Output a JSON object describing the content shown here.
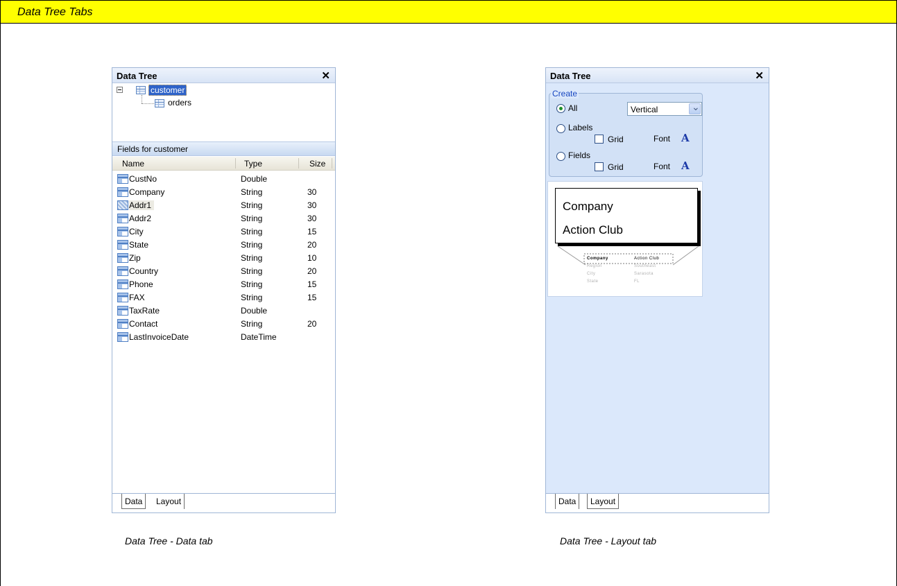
{
  "banner": {
    "title": "Data Tree Tabs"
  },
  "left_panel": {
    "title": "Data Tree",
    "close_glyph": "✕",
    "tree": {
      "root": {
        "label": "customer",
        "icon": "table-icon"
      },
      "child": {
        "label": "orders",
        "icon": "table-icon"
      }
    },
    "fields_header": "Fields for customer",
    "columns": {
      "name": "Name",
      "type": "Type",
      "size": "Size"
    },
    "fields": [
      {
        "name": "CustNo",
        "type": "Double",
        "size": ""
      },
      {
        "name": "Company",
        "type": "String",
        "size": "30"
      },
      {
        "name": "Addr1",
        "type": "String",
        "size": "30"
      },
      {
        "name": "Addr2",
        "type": "String",
        "size": "30"
      },
      {
        "name": "City",
        "type": "String",
        "size": "15"
      },
      {
        "name": "State",
        "type": "String",
        "size": "20"
      },
      {
        "name": "Zip",
        "type": "String",
        "size": "10"
      },
      {
        "name": "Country",
        "type": "String",
        "size": "20"
      },
      {
        "name": "Phone",
        "type": "String",
        "size": "15"
      },
      {
        "name": "FAX",
        "type": "String",
        "size": "15"
      },
      {
        "name": "TaxRate",
        "type": "Double",
        "size": ""
      },
      {
        "name": "Contact",
        "type": "String",
        "size": "20"
      },
      {
        "name": "LastInvoiceDate",
        "type": "DateTime",
        "size": ""
      }
    ],
    "tabs": {
      "data": "Data",
      "layout": "Layout"
    },
    "caption": "Data Tree - Data tab"
  },
  "right_panel": {
    "title": "Data Tree",
    "close_glyph": "✕",
    "create": {
      "legend": "Create",
      "all_label": "All",
      "orientation_value": "Vertical",
      "labels_label": "Labels",
      "fields_label": "Fields",
      "grid_label": "Grid",
      "font_label": "Font",
      "font_glyph": "A"
    },
    "preview": {
      "big_label": "Company",
      "big_value": "Action Club",
      "mini": [
        {
          "label": "Company",
          "value": "Action Club"
        },
        {
          "label": "Region",
          "value": "Southeast"
        },
        {
          "label": "City",
          "value": "Sarasota"
        },
        {
          "label": "State",
          "value": "FL"
        }
      ]
    },
    "tabs": {
      "data": "Data",
      "layout": "Layout"
    },
    "caption": "Data Tree - Layout tab"
  }
}
